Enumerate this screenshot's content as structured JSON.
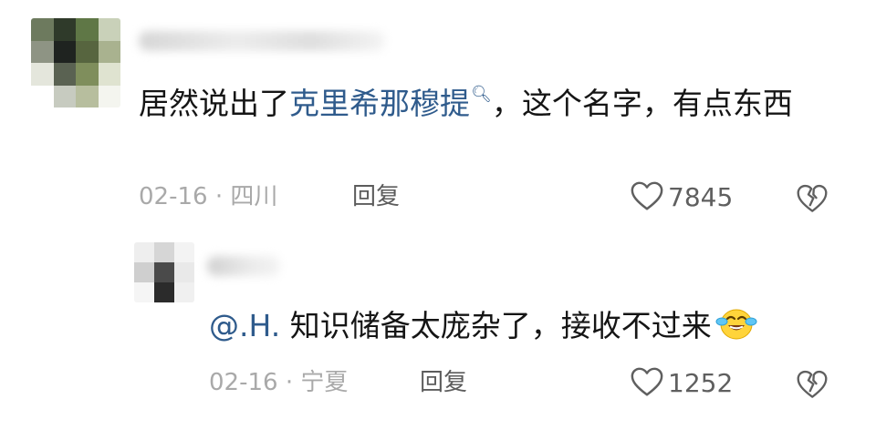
{
  "comments": [
    {
      "text_before": "居然说出了",
      "link_text": "克里希那穆提",
      "search_icon": "search-icon",
      "text_after": "，这个名字，有点东西",
      "date": "02-16",
      "separator": "·",
      "location": "四川",
      "reply_label": "回复",
      "likes": "7845",
      "like_icon": "heart-outline-icon",
      "dislike_icon": "broken-heart-icon"
    },
    {
      "mention": "@.H.",
      "text": " 知识储备太庞杂了，接收不过来",
      "emoji": "crying-laughing-emoji",
      "date": "02-16",
      "separator": "·",
      "location": "宁夏",
      "reply_label": "回复",
      "likes": "1252",
      "like_icon": "heart-outline-icon",
      "dislike_icon": "broken-heart-icon"
    }
  ],
  "colors": {
    "link": "#2f5b8c",
    "meta": "#a9a9a9",
    "text": "#151515"
  }
}
